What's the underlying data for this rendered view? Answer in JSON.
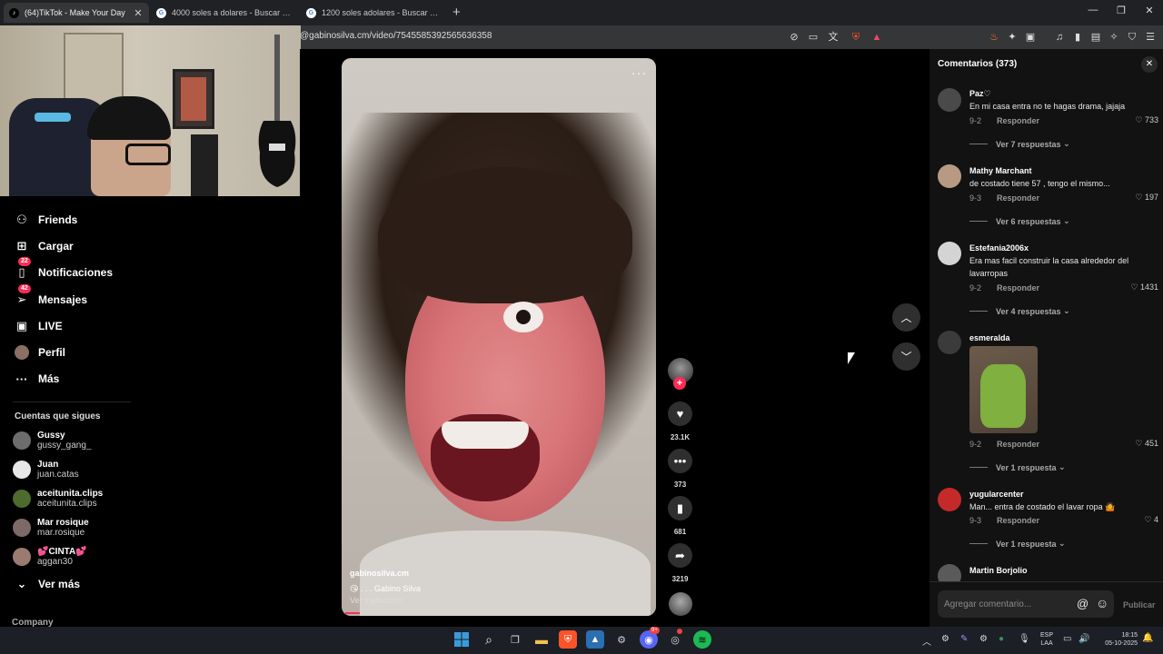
{
  "browser": {
    "tabs": [
      {
        "title": "(64)TikTok - Make Your Day",
        "active": true
      },
      {
        "title": "4000 soles a dolares - Buscar con Go",
        "active": false
      },
      {
        "title": "1200 soles adolares - Buscar con Go",
        "active": false
      }
    ],
    "url": "@gabinosilva.cm/video/7545585392565636358"
  },
  "sidebar": {
    "nav": [
      {
        "label": "Friends",
        "icon": "users-icon"
      },
      {
        "label": "Cargar",
        "icon": "upload-icon"
      },
      {
        "label": "Notificaciones",
        "icon": "bell-icon",
        "badge": "22"
      },
      {
        "label": "Mensajes",
        "icon": "send-icon",
        "badge": "42"
      },
      {
        "label": "LIVE",
        "icon": "live-icon"
      },
      {
        "label": "Perfil",
        "icon": "profile-icon"
      },
      {
        "label": "Más",
        "icon": "more-icon"
      }
    ],
    "following_title": "Cuentas que sigues",
    "following": [
      {
        "name": "Gussy",
        "handle": "gussy_gang_"
      },
      {
        "name": "Juan",
        "handle": "juan.catas"
      },
      {
        "name": "aceitunita.clips",
        "handle": "aceitunita.clips"
      },
      {
        "name": "Mar rosique",
        "handle": "mar.rosique"
      },
      {
        "name": "💕CINTA💕",
        "handle": "aggan30"
      }
    ],
    "see_more": "Ver más",
    "footer": "Company"
  },
  "video": {
    "author": "gabinosilva.cm",
    "description": "😘 . . . Gabino Silva",
    "translate": "Ver traducción",
    "likes": "23.1K",
    "comments": "373",
    "saves": "681",
    "shares": "3219"
  },
  "comments_panel": {
    "title": "Comentarios (373)",
    "input_placeholder": "Agregar comentario...",
    "publish": "Publicar",
    "reply_label": "Responder",
    "items": [
      {
        "user": "Paz♡",
        "text": "En mi casa entra no te hagas drama, jajaja",
        "date": "9-2",
        "likes": "733",
        "replies": "Ver 7 respuestas"
      },
      {
        "user": "Mathy Marchant",
        "text": "de costado tiene 57 , tengo el mismo...",
        "date": "9-3",
        "likes": "197",
        "replies": "Ver 6 respuestas"
      },
      {
        "user": "Estefania2006x",
        "text": "Era mas facil construir la casa alrededor del lavarropas",
        "date": "9-2",
        "likes": "1431",
        "replies": "Ver 4 respuestas"
      },
      {
        "user": "esmeralda",
        "text": "",
        "date": "9-2",
        "likes": "451",
        "replies": "Ver 1 respuesta"
      },
      {
        "user": "yugularcenter",
        "text": "Man... entra de costado el lavar ropa 🤷",
        "date": "9-3",
        "likes": "4",
        "replies": "Ver 1 respuesta"
      },
      {
        "user": "Martin Borjolio",
        "text": "",
        "date": "",
        "likes": "",
        "replies": ""
      }
    ]
  },
  "taskbar": {
    "lang1": "ESP",
    "lang2": "LAA",
    "time": "18:15",
    "date": "05-10-2025",
    "discord_badge": "9+"
  },
  "colors": {
    "accent": "#fe2c55",
    "panel": "#121212",
    "background": "#000000"
  }
}
